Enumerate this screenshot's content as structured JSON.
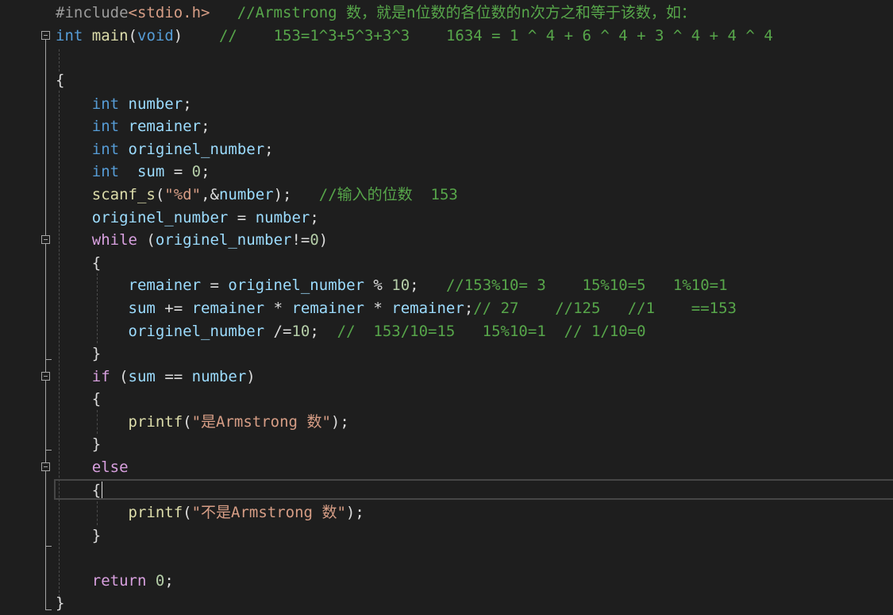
{
  "editor": {
    "language": "C",
    "theme_colors": {
      "background": "#1e1e1e",
      "keyword": "#569cd6",
      "control": "#d8a0df",
      "function": "#dcdcaa",
      "variable": "#9cdcfe",
      "number": "#b5cea8",
      "string": "#d69d85",
      "comment": "#57a64a",
      "preprocessor": "#9b9b9b"
    },
    "lines": [
      {
        "tokens": [
          {
            "t": "#include",
            "k": "pre"
          },
          {
            "t": "<stdio.h>",
            "k": "inc"
          },
          {
            "t": "   //Armstrong 数，就是n位数的各位数的n次方之和等于该数，如：",
            "k": "com"
          }
        ]
      },
      {
        "tokens": [
          {
            "t": "int",
            "k": "ty"
          },
          {
            "t": " ",
            "k": "pl"
          },
          {
            "t": "main",
            "k": "fn"
          },
          {
            "t": "(",
            "k": "pl"
          },
          {
            "t": "void",
            "k": "ty"
          },
          {
            "t": ")",
            "k": "pl"
          },
          {
            "t": "    //    153=1^3+5^3+3^3    1634 = 1 ^ 4 + 6 ^ 4 + 3 ^ 4 + 4 ^ 4",
            "k": "com"
          }
        ]
      },
      {
        "tokens": []
      },
      {
        "tokens": [
          {
            "t": "{",
            "k": "pl"
          }
        ]
      },
      {
        "tokens": [
          {
            "t": "    ",
            "k": "pl"
          },
          {
            "t": "int",
            "k": "ty"
          },
          {
            "t": " ",
            "k": "pl"
          },
          {
            "t": "number",
            "k": "var"
          },
          {
            "t": ";",
            "k": "pl"
          }
        ]
      },
      {
        "tokens": [
          {
            "t": "    ",
            "k": "pl"
          },
          {
            "t": "int",
            "k": "ty"
          },
          {
            "t": " ",
            "k": "pl"
          },
          {
            "t": "remainer",
            "k": "var"
          },
          {
            "t": ";",
            "k": "pl"
          }
        ]
      },
      {
        "tokens": [
          {
            "t": "    ",
            "k": "pl"
          },
          {
            "t": "int",
            "k": "ty"
          },
          {
            "t": " ",
            "k": "pl"
          },
          {
            "t": "originel_number",
            "k": "var"
          },
          {
            "t": ";",
            "k": "pl"
          }
        ]
      },
      {
        "tokens": [
          {
            "t": "    ",
            "k": "pl"
          },
          {
            "t": "int",
            "k": "ty"
          },
          {
            "t": "  ",
            "k": "pl"
          },
          {
            "t": "sum",
            "k": "var"
          },
          {
            "t": " = ",
            "k": "pl"
          },
          {
            "t": "0",
            "k": "num"
          },
          {
            "t": ";",
            "k": "pl"
          }
        ]
      },
      {
        "tokens": [
          {
            "t": "    ",
            "k": "pl"
          },
          {
            "t": "scanf_s",
            "k": "fn"
          },
          {
            "t": "(",
            "k": "pl"
          },
          {
            "t": "\"%d\"",
            "k": "str"
          },
          {
            "t": ",&",
            "k": "pl"
          },
          {
            "t": "number",
            "k": "var"
          },
          {
            "t": ");   ",
            "k": "pl"
          },
          {
            "t": "//输入的位数  153",
            "k": "com"
          }
        ]
      },
      {
        "tokens": [
          {
            "t": "    ",
            "k": "pl"
          },
          {
            "t": "originel_number",
            "k": "var"
          },
          {
            "t": " = ",
            "k": "pl"
          },
          {
            "t": "number",
            "k": "var"
          },
          {
            "t": ";",
            "k": "pl"
          }
        ]
      },
      {
        "tokens": [
          {
            "t": "    ",
            "k": "pl"
          },
          {
            "t": "while",
            "k": "ctl"
          },
          {
            "t": " (",
            "k": "pl"
          },
          {
            "t": "originel_number",
            "k": "var"
          },
          {
            "t": "!=",
            "k": "pl"
          },
          {
            "t": "0",
            "k": "num"
          },
          {
            "t": ")",
            "k": "pl"
          }
        ]
      },
      {
        "tokens": [
          {
            "t": "    {",
            "k": "pl"
          }
        ]
      },
      {
        "tokens": [
          {
            "t": "        ",
            "k": "pl"
          },
          {
            "t": "remainer",
            "k": "var"
          },
          {
            "t": " = ",
            "k": "pl"
          },
          {
            "t": "originel_number",
            "k": "var"
          },
          {
            "t": " % ",
            "k": "pl"
          },
          {
            "t": "10",
            "k": "num"
          },
          {
            "t": ";   ",
            "k": "pl"
          },
          {
            "t": "//153%10= 3    15%10=5   1%10=1",
            "k": "com"
          }
        ]
      },
      {
        "tokens": [
          {
            "t": "        ",
            "k": "pl"
          },
          {
            "t": "sum",
            "k": "var"
          },
          {
            "t": " += ",
            "k": "pl"
          },
          {
            "t": "remainer",
            "k": "var"
          },
          {
            "t": " * ",
            "k": "pl"
          },
          {
            "t": "remainer",
            "k": "var"
          },
          {
            "t": " * ",
            "k": "pl"
          },
          {
            "t": "remainer",
            "k": "var"
          },
          {
            "t": ";",
            "k": "pl"
          },
          {
            "t": "// 27    //125   //1    ==153",
            "k": "com"
          }
        ]
      },
      {
        "tokens": [
          {
            "t": "        ",
            "k": "pl"
          },
          {
            "t": "originel_number",
            "k": "var"
          },
          {
            "t": " /=",
            "k": "pl"
          },
          {
            "t": "10",
            "k": "num"
          },
          {
            "t": ";  ",
            "k": "pl"
          },
          {
            "t": "//  153/10=15   15%10=1  // 1/10=0",
            "k": "com"
          }
        ]
      },
      {
        "tokens": [
          {
            "t": "    }",
            "k": "pl"
          }
        ]
      },
      {
        "tokens": [
          {
            "t": "    ",
            "k": "pl"
          },
          {
            "t": "if",
            "k": "ctl"
          },
          {
            "t": " (",
            "k": "pl"
          },
          {
            "t": "sum",
            "k": "var"
          },
          {
            "t": " == ",
            "k": "pl"
          },
          {
            "t": "number",
            "k": "var"
          },
          {
            "t": ")",
            "k": "pl"
          }
        ]
      },
      {
        "tokens": [
          {
            "t": "    {",
            "k": "pl"
          }
        ]
      },
      {
        "tokens": [
          {
            "t": "        ",
            "k": "pl"
          },
          {
            "t": "printf",
            "k": "fn"
          },
          {
            "t": "(",
            "k": "pl"
          },
          {
            "t": "\"是Armstrong 数\"",
            "k": "str"
          },
          {
            "t": ");",
            "k": "pl"
          }
        ]
      },
      {
        "tokens": [
          {
            "t": "    }",
            "k": "pl"
          }
        ]
      },
      {
        "tokens": [
          {
            "t": "    ",
            "k": "pl"
          },
          {
            "t": "else",
            "k": "ctl"
          }
        ]
      },
      {
        "tokens": [
          {
            "t": "    {",
            "k": "pl"
          }
        ]
      },
      {
        "tokens": [
          {
            "t": "        ",
            "k": "pl"
          },
          {
            "t": "printf",
            "k": "fn"
          },
          {
            "t": "(",
            "k": "pl"
          },
          {
            "t": "\"不是Armstrong 数\"",
            "k": "str"
          },
          {
            "t": ");",
            "k": "pl"
          }
        ]
      },
      {
        "tokens": [
          {
            "t": "    }",
            "k": "pl"
          }
        ]
      },
      {
        "tokens": []
      },
      {
        "tokens": [
          {
            "t": "    ",
            "k": "pl"
          },
          {
            "t": "return",
            "k": "ctl"
          },
          {
            "t": " ",
            "k": "pl"
          },
          {
            "t": "0",
            "k": "num"
          },
          {
            "t": ";",
            "k": "pl"
          }
        ]
      },
      {
        "tokens": [
          {
            "t": "}",
            "k": "pl"
          }
        ]
      }
    ]
  }
}
